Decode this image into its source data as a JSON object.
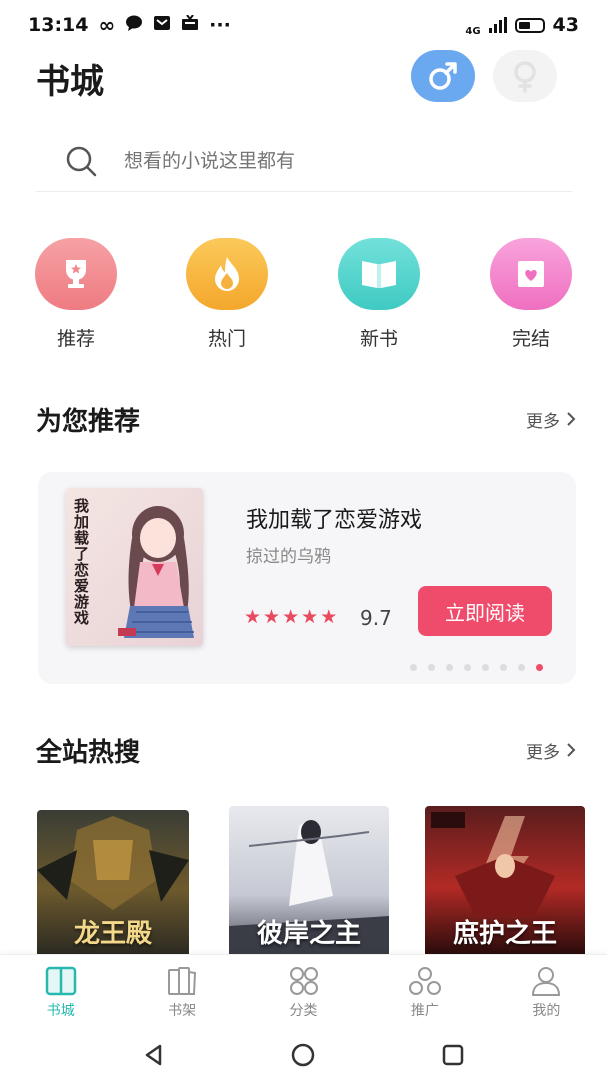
{
  "status_bar": {
    "time": "13:14",
    "network": "4G",
    "battery": "43"
  },
  "header": {
    "title": "书城"
  },
  "search": {
    "placeholder": "想看的小说这里都有"
  },
  "categories": [
    {
      "label": "推荐",
      "icon": "trophy-icon",
      "color": "#f08a8f"
    },
    {
      "label": "热门",
      "icon": "flame-icon",
      "color": "#f7b43d"
    },
    {
      "label": "新书",
      "icon": "book-icon",
      "color": "#55d6cf"
    },
    {
      "label": "完结",
      "icon": "heart-icon",
      "color": "#f37fc7"
    }
  ],
  "recommend": {
    "section_title": "为您推荐",
    "more_label": "更多",
    "book": {
      "title": "我加载了恋爱游戏",
      "author": "掠过的乌鸦",
      "rating": 9.7,
      "stars": 5,
      "cover_text": "我加载了恋爱游戏",
      "read_label": "立即阅读"
    },
    "pages": 8,
    "active_page": 8
  },
  "hot_search": {
    "section_title": "全站热搜",
    "more_label": "更多",
    "books": [
      {
        "cover_title": "龙王殿"
      },
      {
        "cover_title": "彼岸之主"
      },
      {
        "cover_title": "庶护之王"
      }
    ]
  },
  "tab_bar": {
    "tabs": [
      {
        "label": "书城",
        "icon": "bookstore-icon",
        "active": true
      },
      {
        "label": "书架",
        "icon": "bookshelf-icon",
        "active": false
      },
      {
        "label": "分类",
        "icon": "category-icon",
        "active": false
      },
      {
        "label": "推广",
        "icon": "share-icon",
        "active": false
      },
      {
        "label": "我的",
        "icon": "profile-icon",
        "active": false
      }
    ]
  },
  "colors": {
    "accent": "#27b8b0",
    "primary_button": "#ef4b6b",
    "male_toggle": "#6aa8ef"
  }
}
